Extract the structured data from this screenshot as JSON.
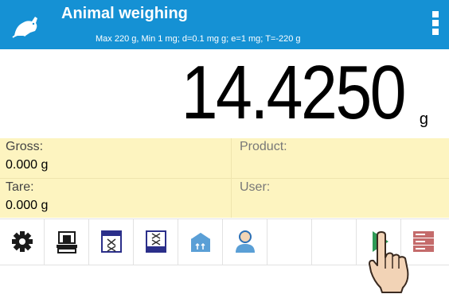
{
  "header": {
    "title": "Animal weighing",
    "subtitle": "Max 220 g, Min 1 mg; d=0.1 mg g; e=1 mg; T=-220 g",
    "mode_icon": "rat-icon",
    "menu_icon": "kebab-menu-icon",
    "background_color": "#1591d4"
  },
  "display": {
    "weight": "14.4250",
    "unit": "g"
  },
  "info": {
    "gross_label": "Gross:",
    "gross_value": "0.000 g",
    "tare_label": "Tare:",
    "tare_value": "0.000 g",
    "product_label": "Product:",
    "product_value": "",
    "user_label": "User:",
    "user_value": "",
    "background_color": "#fdf4c0"
  },
  "toolbar": {
    "buttons": [
      {
        "icon": "gear-icon"
      },
      {
        "icon": "scale-icon"
      },
      {
        "icon": "x-box-icon"
      },
      {
        "icon": "x-box-double-icon"
      },
      {
        "icon": "package-tare-icon"
      },
      {
        "icon": "user-icon"
      },
      {
        "icon": ""
      },
      {
        "icon": ""
      },
      {
        "icon": "play-icon"
      },
      {
        "icon": "database-icon"
      }
    ]
  }
}
